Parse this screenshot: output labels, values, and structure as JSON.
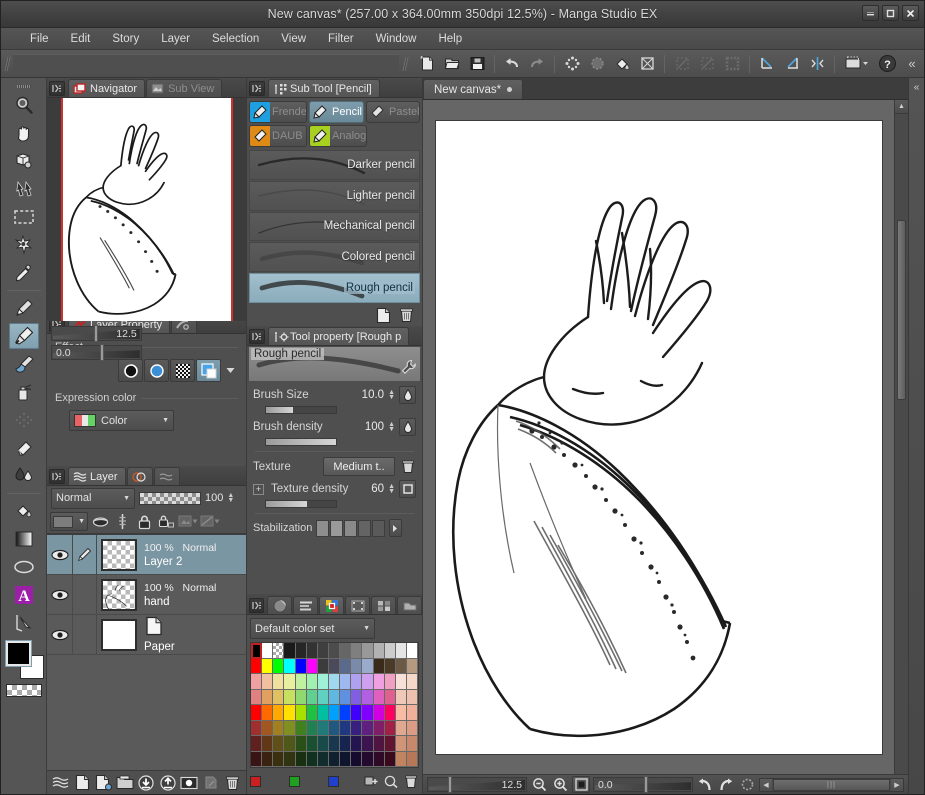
{
  "window": {
    "title": "New canvas* (257.00 x 364.00mm 350dpi 12.5%)  - Manga Studio EX",
    "minimize": "—",
    "maximize": "▢",
    "close": "✕"
  },
  "menubar": {
    "items": [
      "File",
      "Edit",
      "Story",
      "Layer",
      "Selection",
      "View",
      "Filter",
      "Window",
      "Help"
    ]
  },
  "command_bar": {
    "buttons": [
      "new-file-icon",
      "open-file-icon",
      "save-file-icon",
      "undo-icon",
      "redo-icon",
      "select-all-icon",
      "deselect-icon",
      "fill-icon",
      "transform-icon",
      "clear-icon",
      "invert-icon",
      "selection-border-icon",
      "ruler-snap-icon",
      "ruler-parallel-icon",
      "ruler-symmetry-icon",
      "frame-border-icon",
      "help-icon"
    ],
    "collapse": "«"
  },
  "tool_palette": {
    "tools": [
      {
        "name": "magnifier-tool",
        "selected": false
      },
      {
        "name": "hand-tool",
        "selected": false
      },
      {
        "name": "rotate-tool",
        "selected": false
      },
      {
        "name": "move-tool",
        "selected": false
      },
      {
        "name": "marquee-tool",
        "selected": false
      },
      {
        "name": "auto-select-tool",
        "selected": false
      },
      {
        "name": "eyedropper-tool",
        "selected": false
      },
      {
        "name": "pen-tool",
        "selected": false
      },
      {
        "name": "pencil-tool",
        "selected": true
      },
      {
        "name": "brush-tool",
        "selected": false
      },
      {
        "name": "airbrush-tool",
        "selected": false
      },
      {
        "name": "decoration-tool",
        "selected": false
      },
      {
        "name": "eraser-tool",
        "selected": false
      },
      {
        "name": "blend-tool",
        "selected": false
      },
      {
        "name": "fill-tool",
        "selected": false
      },
      {
        "name": "gradient-tool",
        "selected": false
      },
      {
        "name": "figure-tool",
        "selected": false
      },
      {
        "name": "text-tool",
        "selected": false,
        "glyph": "A"
      },
      {
        "name": "ruler-tool",
        "selected": false
      }
    ],
    "colors": {
      "foreground": "#000000",
      "background": "#ffffff"
    }
  },
  "navigator": {
    "tabs": [
      {
        "label": "Navigator",
        "active": true,
        "icon": "navigator-icon"
      },
      {
        "label": "Sub View",
        "active": false,
        "icon": "subview-icon"
      }
    ],
    "zoom_value": "12.5",
    "rotation_value": "0.0"
  },
  "layer_property": {
    "tabs": [
      {
        "label": "Layer Property",
        "active": true,
        "icon": "layer-property-icon"
      },
      {
        "label": "",
        "active": false,
        "icon": "brush-settings-icon"
      }
    ],
    "effect_label": "Effect",
    "effect_buttons": [
      "border-effect-icon",
      "tone-effect-icon",
      "halftone-effect-icon",
      "layer-color-effect-icon"
    ],
    "expression_color_label": "Expression color",
    "expression_color_value": "Color"
  },
  "layer_panel": {
    "tabs": [
      {
        "label": "Layer",
        "active": true,
        "icon": "layer-icon"
      },
      {
        "label": "",
        "active": false,
        "icon": "animation-icon"
      },
      {
        "label": "",
        "active": false,
        "icon": "layer-mask-icon"
      }
    ],
    "blend_mode": "Normal",
    "opacity": "100",
    "toolbar": [
      "layer-color-swatch",
      "mask-icon",
      "ruler-icon",
      "lock-icon",
      "lock-transparent-icon",
      "clip-icon",
      "mask-apply-icon"
    ],
    "columns": [
      "visibility",
      "draft"
    ],
    "layers": [
      {
        "name": "Layer 2",
        "opacity": "100 %",
        "blend": "Normal",
        "visible": true,
        "selected": true,
        "type": "raster",
        "has_pen_icon": true
      },
      {
        "name": "hand",
        "opacity": "100 %",
        "blend": "Normal",
        "visible": true,
        "selected": false,
        "type": "raster",
        "has_pen_icon": false
      },
      {
        "name": "Paper",
        "opacity": "",
        "blend": "",
        "visible": true,
        "selected": false,
        "type": "paper",
        "has_pen_icon": false
      }
    ],
    "footer_buttons": [
      "palette-icon",
      "new-raster-layer-icon",
      "new-vector-layer-icon",
      "new-folder-icon",
      "merge-down-icon",
      "merge-visible-icon",
      "layer-mask-icon",
      "transfer-icon",
      "delete-layer-icon"
    ]
  },
  "sub_tool": {
    "title": "Sub Tool [Pencil]",
    "tabs": [
      {
        "label": "Frende",
        "active": false,
        "swatch": "#1e9fe0"
      },
      {
        "label": "Pencil",
        "active": true,
        "swatch": "#6f8f9f"
      },
      {
        "label": "Pastel",
        "active": false,
        "swatch": "#9a9a9a"
      },
      {
        "label": "DAUB",
        "active": false,
        "swatch": "#e08a16"
      },
      {
        "label": "Analog",
        "active": false,
        "swatch": "#a8d020"
      }
    ],
    "items": [
      {
        "label": "Darker pencil",
        "selected": false
      },
      {
        "label": "Lighter pencil",
        "selected": false
      },
      {
        "label": "Mechanical pencil",
        "selected": false
      },
      {
        "label": "Colored pencil",
        "selected": false
      },
      {
        "label": "Rough pencil",
        "selected": true
      }
    ],
    "footer_buttons": [
      "new-sub-tool-icon",
      "delete-sub-tool-icon"
    ]
  },
  "tool_property": {
    "title": "Tool property [Rough p",
    "preset_name": "Rough pencil",
    "properties": [
      {
        "label": "Brush Size",
        "value": "10.0",
        "fill": 38
      },
      {
        "label": "Brush density",
        "value": "100",
        "fill": 100
      }
    ],
    "texture_label": "Texture",
    "texture_value": "Medium t..",
    "texture_density_label": "Texture density",
    "texture_density_value": "60",
    "texture_density_fill": 58,
    "stabilization_label": "Stabilization",
    "stabilization_cells": [
      "#8e8e8e",
      "#9a9a9a",
      "#8a8a8a",
      "#646464",
      "#5a5a5a"
    ]
  },
  "color_set": {
    "tabs": [
      "color-wheel-icon",
      "color-slider-icon",
      "color-set-icon",
      "color-history-icon",
      "intermediate-color-icon",
      "approx-color-icon"
    ],
    "active_tab_index": 2,
    "set_name": "Default color set",
    "selected_swatch": "#000000",
    "palette_rows": [
      [
        "#000000",
        "#ffffff",
        "transparent",
        "#1a1a1a",
        "#262626",
        "#333333",
        "#3f3f3f",
        "#4c4c4c",
        "#666666",
        "#7f7f7f",
        "#999999",
        "#b2b2b2",
        "#cccccc",
        "#e5e5e5",
        "#ffffff"
      ],
      [
        "#ff0000",
        "#ffff00",
        "#00ff00",
        "#00ffff",
        "#0000ff",
        "#ff00ff",
        "#3c3c3c",
        "#4a4a5a",
        "#5a6a8a",
        "#7a8aaa",
        "#9aaaca",
        "#3a2a1a",
        "#4a3a26",
        "#6b5a46",
        "#b59a80"
      ],
      [
        "#f0a0a0",
        "#f0c0a0",
        "#f0e0a0",
        "#e8f0a0",
        "#c0f0a0",
        "#a0f0b0",
        "#a0f0d8",
        "#a0d8f0",
        "#a0b8f0",
        "#b0a0f0",
        "#d0a0f0",
        "#f0a0e0",
        "#f0a0c0",
        "#f7e0d8",
        "#f5d8c8"
      ],
      [
        "#e08080",
        "#e0a060",
        "#e0c060",
        "#c8e060",
        "#90d870",
        "#60d090",
        "#60d0c0",
        "#60b8e0",
        "#6090e0",
        "#8060e0",
        "#b060e0",
        "#e060c0",
        "#e06090",
        "#f0c8b8",
        "#eec0ae"
      ],
      [
        "#ff0000",
        "#ff6a00",
        "#ffa800",
        "#ffe000",
        "#a8e000",
        "#20c040",
        "#00c0a0",
        "#00a0ff",
        "#0040ff",
        "#4000ff",
        "#8000ff",
        "#d000e0",
        "#ff0060",
        "#f8bca4",
        "#f0b09a"
      ],
      [
        "#a03030",
        "#a05820",
        "#a08020",
        "#809020",
        "#40801f",
        "#208050",
        "#1f7a78",
        "#205880",
        "#203880",
        "#382080",
        "#602080",
        "#801f68",
        "#a02048",
        "#e0a890",
        "#dc9c84"
      ],
      [
        "#602020",
        "#603818",
        "#605018",
        "#4f5818",
        "#2a5018",
        "#185030",
        "#184a4a",
        "#183850",
        "#182450",
        "#241450",
        "#3c1450",
        "#501440",
        "#601430",
        "#d09478",
        "#c8886c"
      ],
      [
        "#3a1414",
        "#3a2210",
        "#3a3010",
        "#303410",
        "#183010",
        "#103020",
        "#102c2c",
        "#10202e",
        "#10152e",
        "#160a2e",
        "#240a2e",
        "#2e0a26",
        "#3a0a1c",
        "#c08460",
        "#b87858"
      ]
    ],
    "footer_swatches": [
      "#cc2020",
      "#20a020",
      "#2040cc"
    ],
    "footer_buttons": [
      "add-color-icon",
      "edit-color-icon",
      "delete-color-icon"
    ]
  },
  "canvas": {
    "tabs": [
      {
        "label": "New canvas*",
        "modified": true,
        "active": true
      }
    ],
    "artwork_description": "line art of a hand emerging from a patterned sleeve cuff",
    "status": {
      "zoom_value": "12.5",
      "rotation_value": "0.0",
      "zoom_out": "zoom-out-icon",
      "zoom_in": "zoom-in-icon",
      "fit_icon": "fit-to-screen-icon",
      "rotate_left": "rotate-left-icon",
      "rotate_right": "rotate-right-icon",
      "reset_rotation": "reset-rotation-icon"
    }
  }
}
